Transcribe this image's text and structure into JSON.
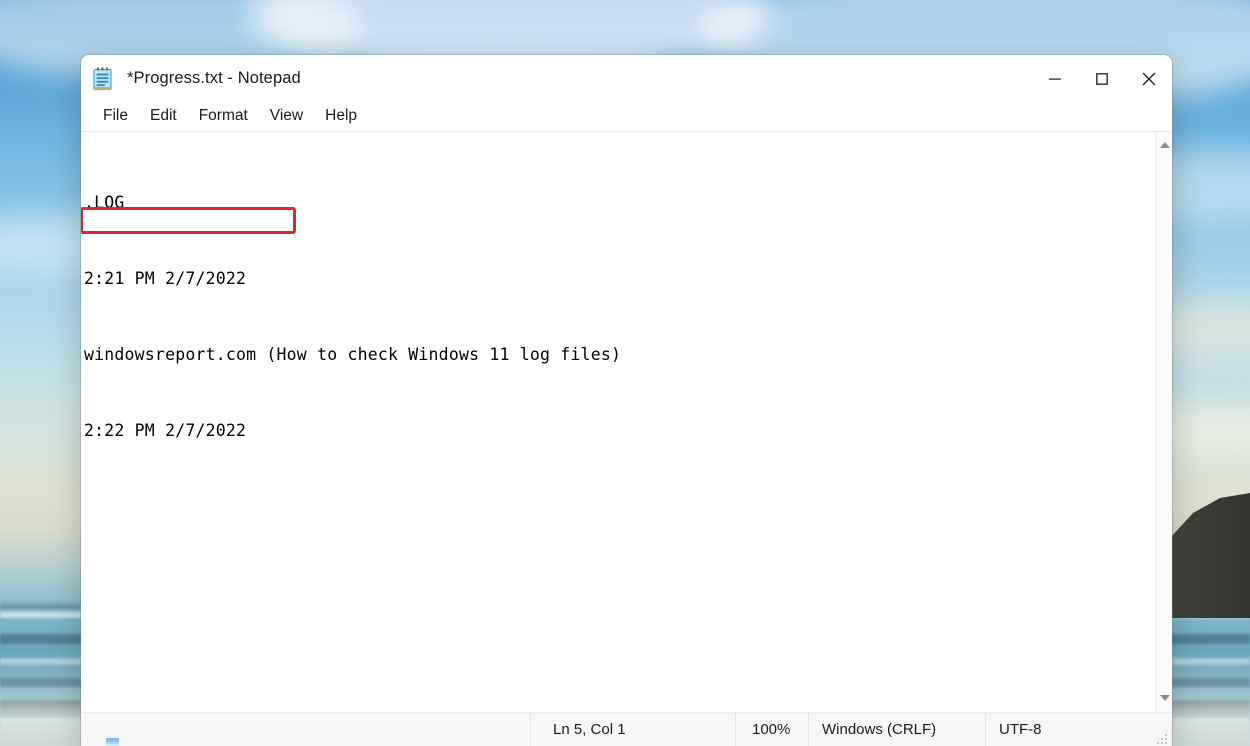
{
  "desktop": {
    "wallpaper_name": "beach-sunset-wallpaper",
    "sky_color": "#2f86c8",
    "sand_color": "#dfe0cf",
    "rock_color": "#3b3c36"
  },
  "window": {
    "title": "*Progress.txt - Notepad",
    "icon": "notepad-icon",
    "controls": {
      "minimize": "—",
      "maximize": "☐",
      "close": "✕",
      "minimize_name": "minimize-button",
      "maximize_name": "maximize-button",
      "close_name": "close-button"
    }
  },
  "menu": {
    "items": [
      {
        "label": "File"
      },
      {
        "label": "Edit"
      },
      {
        "label": "Format"
      },
      {
        "label": "View"
      },
      {
        "label": "Help"
      }
    ]
  },
  "editor": {
    "lines": [
      ".LOG",
      "2:21 PM 2/7/2022",
      "windowsreport.com (How to check Windows 11 log files)",
      "2:22 PM 2/7/2022"
    ],
    "highlight": {
      "name": "annotation-highlight-box",
      "target_line_text": "2:22 PM 2/7/2022",
      "color": "#e0242b"
    }
  },
  "scrollbar": {
    "up_arrow": "scroll-up-arrow",
    "down_arrow": "scroll-down-arrow",
    "orientation": "vertical"
  },
  "status_bar": {
    "line_col": "Ln 5, Col 1",
    "zoom": "100%",
    "line_ending": "Windows (CRLF)",
    "encoding": "UTF-8"
  }
}
